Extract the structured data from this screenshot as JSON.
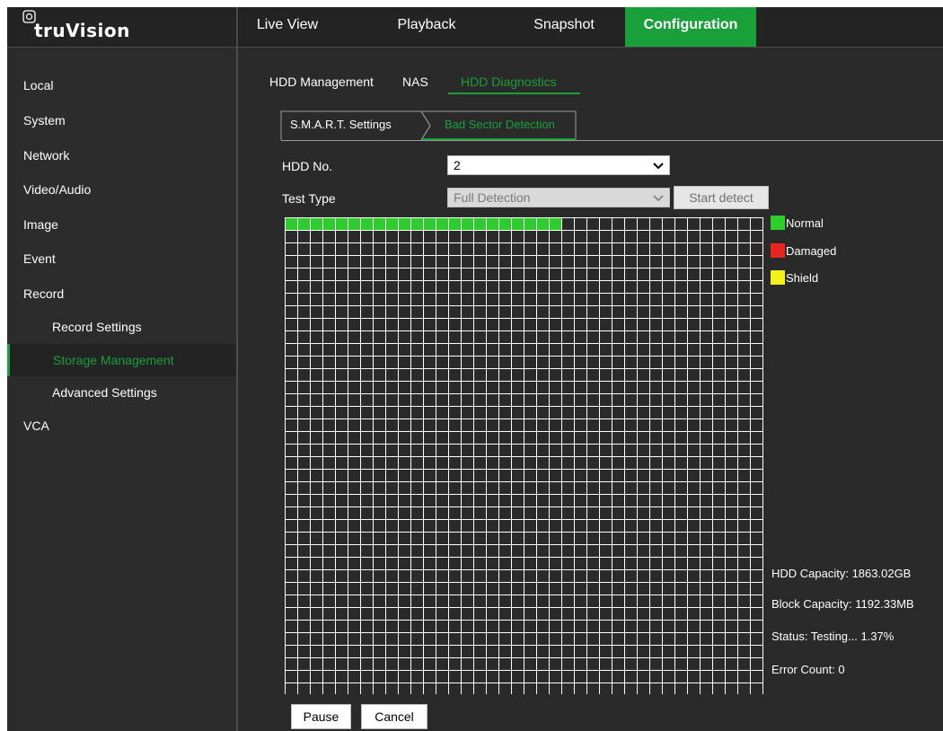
{
  "app": {
    "brand": "truVision"
  },
  "nav": {
    "tabs": [
      {
        "label": "Live View"
      },
      {
        "label": "Playback"
      },
      {
        "label": "Snapshot"
      },
      {
        "label": "Configuration",
        "active": true
      }
    ]
  },
  "sidebar": {
    "items": [
      {
        "label": "Local"
      },
      {
        "label": "System"
      },
      {
        "label": "Network"
      },
      {
        "label": "Video/Audio"
      },
      {
        "label": "Image"
      },
      {
        "label": "Event"
      },
      {
        "label": "Record"
      },
      {
        "label": "Record Settings"
      },
      {
        "label": "Storage Management",
        "active": true
      },
      {
        "label": "Advanced Settings"
      },
      {
        "label": "VCA"
      }
    ]
  },
  "subtabs": [
    {
      "label": "HDD Management"
    },
    {
      "label": "NAS"
    },
    {
      "label": "HDD Diagnostics",
      "active": true
    }
  ],
  "steps": [
    {
      "label": "S.M.A.R.T. Settings"
    },
    {
      "label": "Bad Sector Detection",
      "active": true
    }
  ],
  "form": {
    "hdd_label": "HDD No.",
    "hdd_value": "2",
    "type_label": "Test Type",
    "type_value": "Full Detection",
    "start_label": "Start detect"
  },
  "grid": {
    "normal_blocks": 22
  },
  "legend": [
    {
      "label": "Normal",
      "color": "#2ecc2e"
    },
    {
      "label": "Damaged",
      "color": "#e8261f"
    },
    {
      "label": "Shield",
      "color": "#f2f21a"
    }
  ],
  "info": {
    "capacity": "HDD Capacity: 1863.02GB",
    "block": "Block Capacity: 1192.33MB",
    "status": "Status: Testing... 1.37%",
    "errors": "Error Count: 0"
  },
  "buttons": {
    "pause": "Pause",
    "cancel": "Cancel"
  },
  "colors": {
    "accent": "#1aa03a",
    "background": "#2a2a2a"
  }
}
